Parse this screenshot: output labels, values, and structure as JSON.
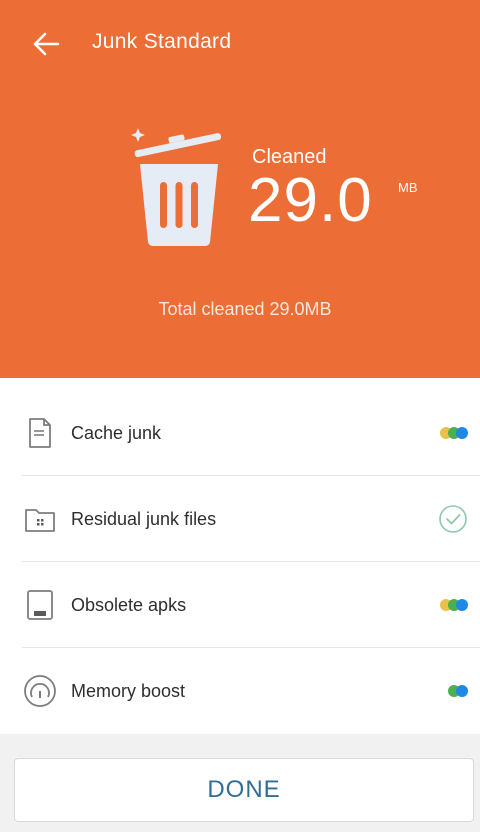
{
  "header": {
    "title": "Junk Standard",
    "back_icon": "arrow-left-icon",
    "trash_icon": "trash-can-icon",
    "cleaned_label": "Cleaned",
    "cleaned_value": "29.0",
    "cleaned_unit": "MB",
    "total_text": "Total cleaned 29.0MB",
    "bg_color": "#ec6d35"
  },
  "list": {
    "items": [
      {
        "label": "Cache junk",
        "icon": "document-icon",
        "status": "scanning"
      },
      {
        "label": "Residual junk files",
        "icon": "folder-icon",
        "status": "done"
      },
      {
        "label": "Obsolete apks",
        "icon": "tablet-icon",
        "status": "scanning"
      },
      {
        "label": "Memory boost",
        "icon": "speedometer-icon",
        "status": "scanning"
      }
    ],
    "dot_colors": [
      "#e8c24a",
      "#4caf50",
      "#1e88e5"
    ],
    "check_color": "#8fc8a8"
  },
  "footer": {
    "done_label": "DONE",
    "done_color": "#2f6f96"
  }
}
